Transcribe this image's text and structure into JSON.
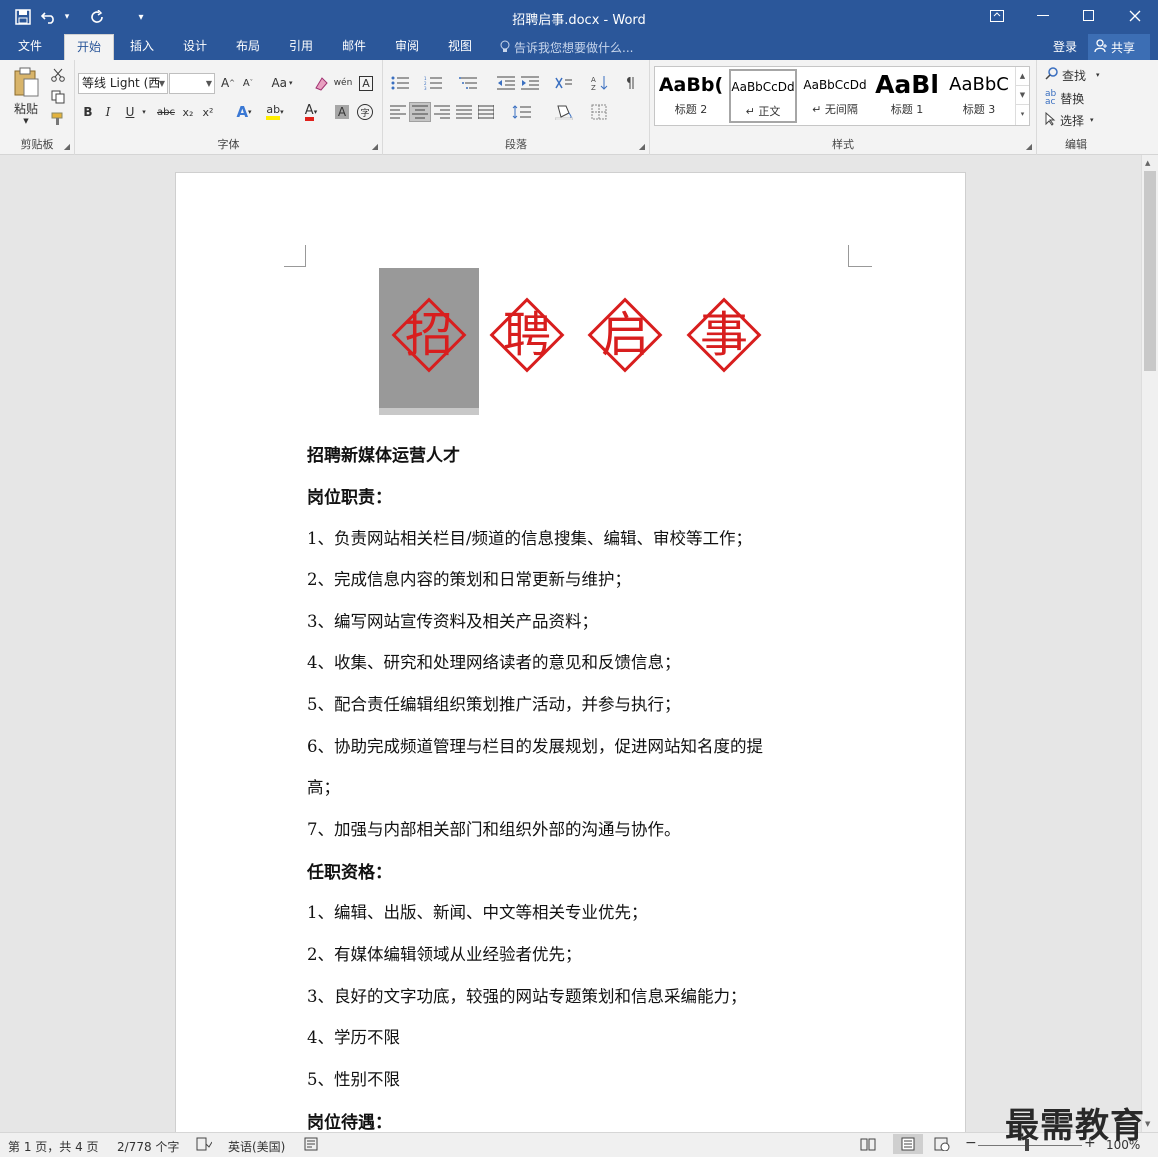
{
  "window": {
    "title": "招聘启事.docx - Word"
  },
  "qat": {
    "save": "💾",
    "undo": "↶",
    "undo_more": "▾",
    "redo": "↻",
    "customize": "▾"
  },
  "tabs": [
    {
      "label": "文件"
    },
    {
      "label": "开始"
    },
    {
      "label": "插入"
    },
    {
      "label": "设计"
    },
    {
      "label": "布局"
    },
    {
      "label": "引用"
    },
    {
      "label": "邮件"
    },
    {
      "label": "审阅"
    },
    {
      "label": "视图"
    }
  ],
  "tell_me": {
    "icon": "lightbulb-icon",
    "placeholder": "告诉我您想要做什么..."
  },
  "account": {
    "login": "登录",
    "share": "共享"
  },
  "ribbon": {
    "clipboard": {
      "paste": "粘贴",
      "label": "剪贴板"
    },
    "font": {
      "font_name": "等线 Light (西",
      "font_size": "",
      "label": "字体",
      "bold": "B",
      "italic": "I",
      "underline": "U",
      "strike": "abc",
      "sub": "x₂",
      "sup": "x²",
      "grow": "A^",
      "shrink": "Aˇ",
      "case": "Aa",
      "clear": "A",
      "phonetic": "wén",
      "border": "A",
      "texteffect": "A",
      "highlight": "ab",
      "fontcolor": "A",
      "shade": "A",
      "enclose": "字"
    },
    "paragraph": {
      "label": "段落"
    },
    "styles": {
      "label": "样式",
      "items": [
        {
          "sample": "AaBb(",
          "name": "标题 2"
        },
        {
          "sample": "AaBbCcDd",
          "name": "↵ 正文"
        },
        {
          "sample": "AaBbCcDd",
          "name": "↵ 无间隔"
        },
        {
          "sample": "AaBl",
          "name": "标题 1"
        },
        {
          "sample": "AaBbC",
          "name": "标题 3"
        }
      ]
    },
    "editing": {
      "find": "查找",
      "replace": "替换",
      "select": "选择",
      "label": "编辑"
    }
  },
  "document": {
    "header_seals": [
      "招",
      "聘",
      "启",
      "事"
    ],
    "colors": {
      "seal_red": "#d81e1e",
      "selection_gray": "#999999"
    },
    "lines": [
      {
        "text": "招聘新媒体运营人才",
        "bold": true
      },
      {
        "text": "岗位职责：",
        "bold": true
      },
      {
        "text": "1、负责网站相关栏目/频道的信息搜集、编辑、审校等工作；"
      },
      {
        "text": "2、完成信息内容的策划和日常更新与维护；"
      },
      {
        "text": "3、编写网站宣传资料及相关产品资料；"
      },
      {
        "text": "4、收集、研究和处理网络读者的意见和反馈信息；"
      },
      {
        "text": "5、配合责任编辑组织策划推广活动，并参与执行；"
      },
      {
        "text": "6、协助完成频道管理与栏目的发展规划，促进网站知名度的提"
      },
      {
        "text": "高；"
      },
      {
        "text": "7、加强与内部相关部门和组织外部的沟通与协作。"
      },
      {
        "text": "任职资格：",
        "bold": true
      },
      {
        "text": "1、编辑、出版、新闻、中文等相关专业优先；"
      },
      {
        "text": "2、有媒体编辑领域从业经验者优先；"
      },
      {
        "text": "3、良好的文字功底，较强的网站专题策划和信息采编能力；"
      },
      {
        "text": "4、学历不限"
      },
      {
        "text": "5、性别不限"
      },
      {
        "text": "岗位待遇：",
        "bold": true
      }
    ]
  },
  "status": {
    "page": "第 1 页，共 4 页",
    "words": "2/778 个字",
    "lang": "英语(美国)",
    "zoom": "100%",
    "zoom_minus": "−",
    "zoom_plus": "+"
  },
  "watermark": "最需教育"
}
